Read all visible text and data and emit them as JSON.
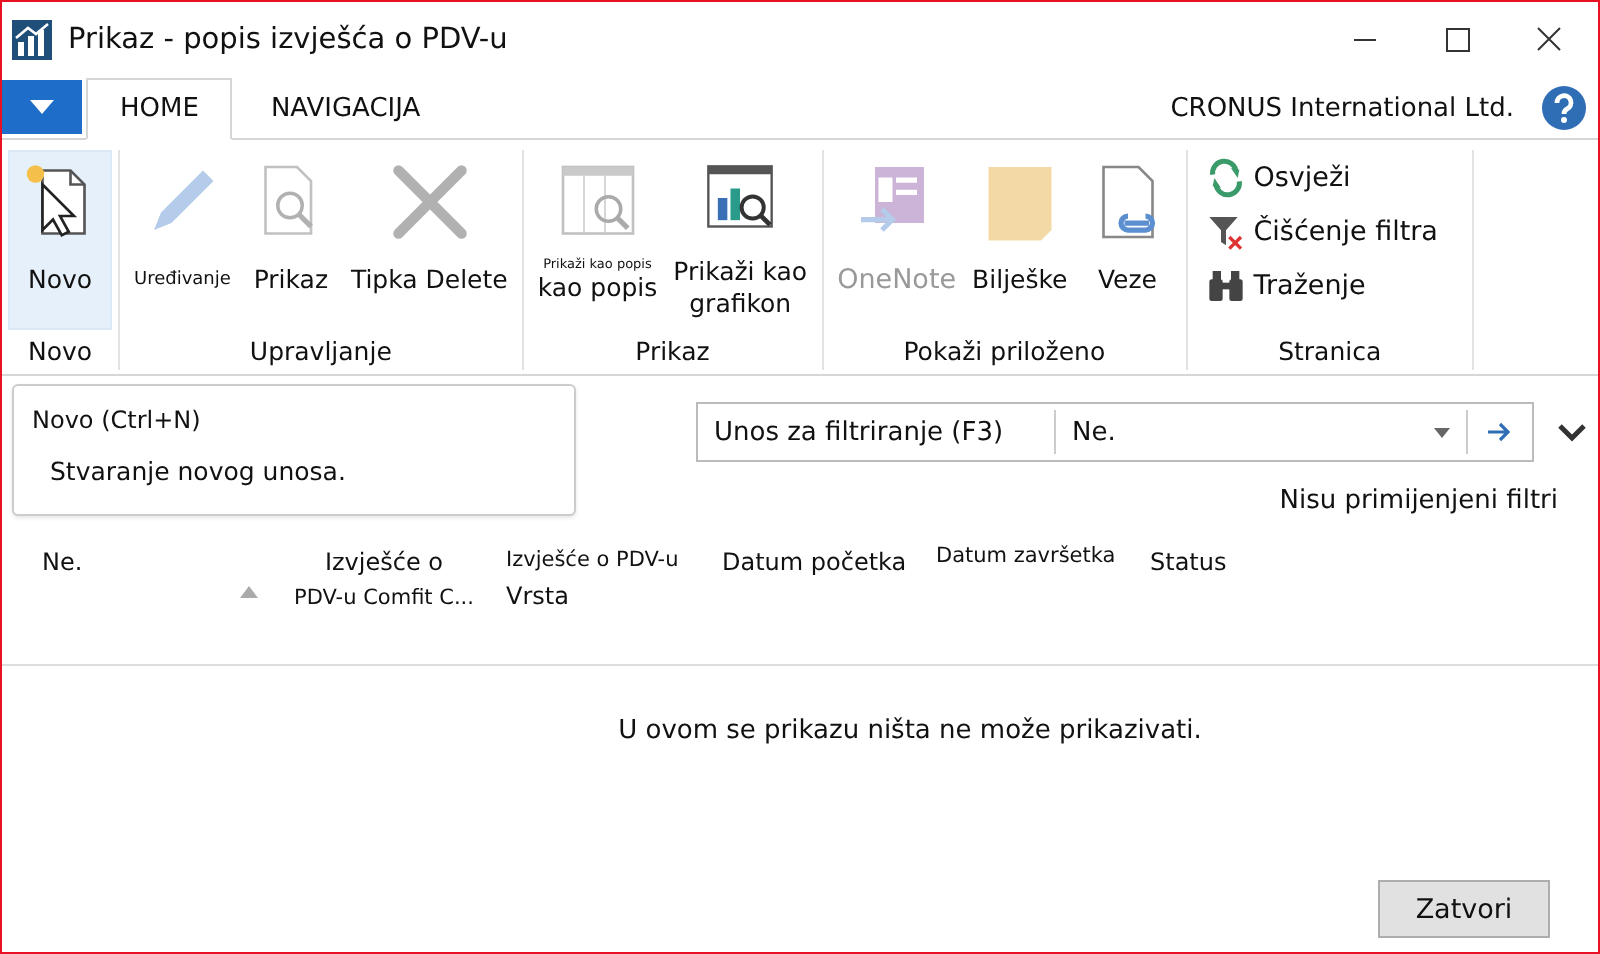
{
  "window": {
    "title": "Prikaz - popis izvješća o PDV-u"
  },
  "tabs": [
    {
      "label": "HOME",
      "selected": true
    },
    {
      "label": "NAVIGACIJA",
      "selected": false
    }
  ],
  "company": "CRONUS International Ltd.",
  "ribbon": [
    {
      "label": "Novo",
      "items": [
        {
          "kind": "large",
          "lines": [
            "Novo"
          ],
          "disabled": false,
          "selected": true
        }
      ]
    },
    {
      "label": "Upravljanje",
      "items": [
        {
          "kind": "large",
          "lines": [
            "Uređivanje"
          ],
          "disabled": true,
          "selected": false
        },
        {
          "kind": "large",
          "lines": [
            "Prikaz"
          ],
          "disabled": true,
          "selected": false
        },
        {
          "kind": "large",
          "lines": [
            "Tipka Delete"
          ],
          "disabled": true,
          "selected": false
        }
      ]
    },
    {
      "label": "Prikaz",
      "items": [
        {
          "kind": "large",
          "lines": [
            "Prikaži kao popis",
            "kao popis"
          ],
          "disabled": true,
          "selected": false
        },
        {
          "kind": "large",
          "lines": [
            "Prikaži kao",
            "grafikon"
          ],
          "disabled": false,
          "selected": false
        }
      ]
    },
    {
      "label": "Pokaži priloženo",
      "items": [
        {
          "kind": "large",
          "lines": [
            "OneNote"
          ],
          "disabled": true,
          "selected": false
        },
        {
          "kind": "large",
          "lines": [
            "Bilješke"
          ],
          "disabled": false,
          "selected": false
        },
        {
          "kind": "large",
          "lines": [
            "Veze"
          ],
          "disabled": false,
          "selected": false
        }
      ]
    },
    {
      "label": "Stranica",
      "items": [
        {
          "kind": "small",
          "lines": [
            "Osvježi"
          ],
          "disabled": false,
          "selected": false
        },
        {
          "kind": "small",
          "lines": [
            "Čišćenje filtra"
          ],
          "disabled": false,
          "selected": false
        },
        {
          "kind": "small",
          "lines": [
            "Traženje"
          ],
          "disabled": false,
          "selected": false
        }
      ]
    }
  ],
  "tooltip": {
    "title": "Novo (Ctrl+N)",
    "text": "Stvaranje novog unosa."
  },
  "filter": {
    "placeholder": "Unos za filtriranje (F3)",
    "field": "Ne."
  },
  "filter_status": "Nisu primijenjeni filtri",
  "table": {
    "columns": [
      {
        "lines": [
          "Ne."
        ],
        "sorted": true
      },
      {
        "lines": [
          "Izvješće o",
          "PDV-u Comfit C..."
        ],
        "sorted": false
      },
      {
        "lines": [
          "Izvješće o PDV-u",
          "Vrsta"
        ],
        "sorted": false
      },
      {
        "lines": [
          "Datum početka"
        ],
        "sorted": false
      },
      {
        "lines": [
          "Datum završetka"
        ],
        "sorted": false
      },
      {
        "lines": [
          "Status"
        ],
        "sorted": false
      }
    ],
    "empty_message": "U ovom se prikazu ništa ne može prikazivati."
  },
  "buttons": [
    "Zatvori"
  ]
}
